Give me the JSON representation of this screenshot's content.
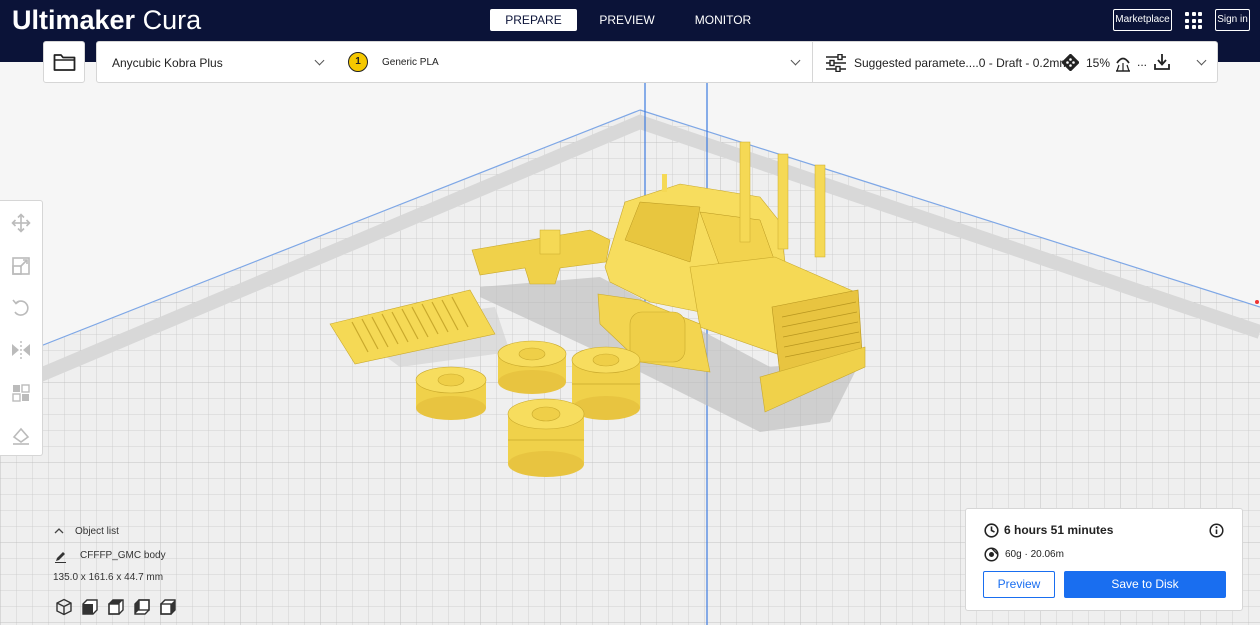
{
  "app": {
    "brand_bold": "Ultimaker",
    "brand_light": "Cura"
  },
  "nav": {
    "tabs": [
      {
        "label": "PREPARE",
        "active": true
      },
      {
        "label": "PREVIEW",
        "active": false
      },
      {
        "label": "MONITOR",
        "active": false
      }
    ],
    "marketplace_label": "Marketplace",
    "signin_label": "Sign in"
  },
  "toolbar": {
    "printer_name": "Anycubic Kobra Plus",
    "extruder_number": "1",
    "material": "Generic PLA",
    "settings_summary": "Suggested paramete....0 - Draft - 0.2mm",
    "infill": "15%",
    "more": "..."
  },
  "object_list": {
    "header": "Object list",
    "object_name": "CFFFP_GMC body",
    "dimensions": "135.0 x 161.6 x 44.7 mm"
  },
  "print_info": {
    "time": "6 hours 51 minutes",
    "material_usage": "60g · 20.06m",
    "preview_label": "Preview",
    "save_label": "Save to Disk"
  },
  "colors": {
    "header_bg": "#0b1338",
    "accent": "#196ef0",
    "model": "#f7dd5e",
    "badge": "#f5c800"
  }
}
